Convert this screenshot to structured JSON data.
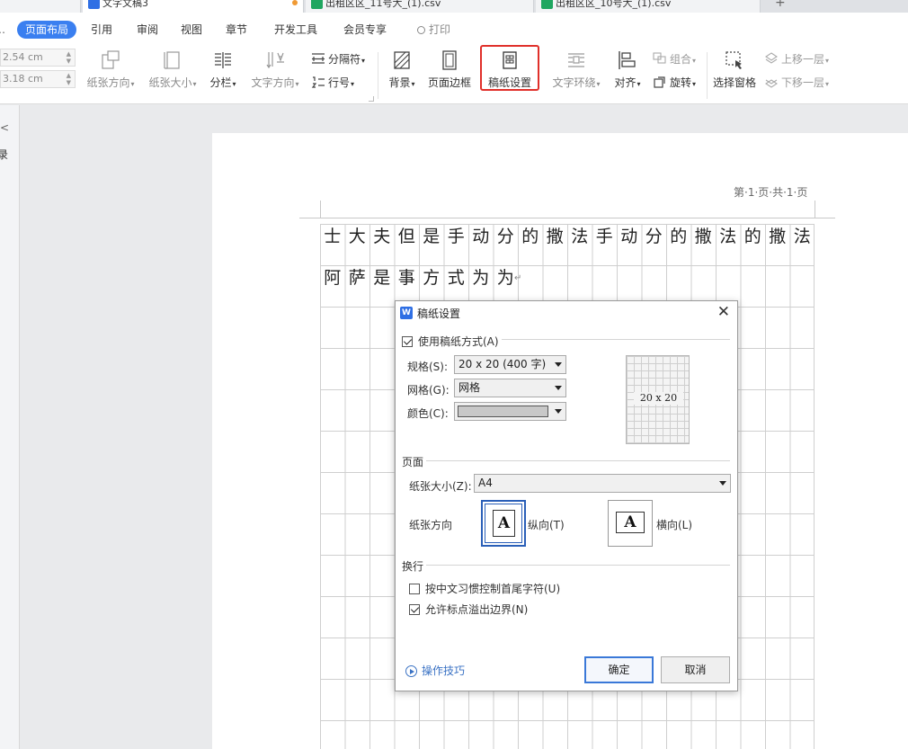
{
  "file_tabs": [
    {
      "label": "",
      "kind": "home"
    },
    {
      "label": "文字文稿3",
      "kind": "writer"
    },
    {
      "label": "出租区区_11号大_(1).csv",
      "kind": "sheet"
    },
    {
      "label": "出租区区_10号大_(1).csv",
      "kind": "sheet"
    }
  ],
  "menu": {
    "items": [
      "页面布局",
      "引用",
      "审阅",
      "视图",
      "章节",
      "开发工具",
      "会员专享"
    ],
    "search_label": "打印"
  },
  "ribbon": {
    "margin_top": "2.54 cm",
    "margin_bottom": "3.18 cm",
    "orientation": "纸张方向",
    "paper_size": "纸张大小",
    "columns": "分栏",
    "text_direction": "文字方向",
    "separator": "分隔符",
    "line_number": "行号",
    "background": "背景",
    "page_border": "页面边框",
    "manuscript": "稿纸设置",
    "text_wrap": "文字环绕",
    "align": "对齐",
    "group": "组合",
    "rotate": "旋转",
    "selection_pane": "选择窗格",
    "bring_forward": "上移一层",
    "send_backward": "下移一层"
  },
  "left_pane": {
    "label": "录"
  },
  "document": {
    "page_number": "第·1·页·共·1·页",
    "line1": [
      "士",
      "大",
      "夫",
      "但",
      "是",
      "手",
      "动",
      "分",
      "的",
      "撒",
      "法",
      "手",
      "动",
      "分",
      "的",
      "撒",
      "法",
      "的",
      "撒",
      "法"
    ],
    "line2": [
      "阿",
      "萨",
      "是",
      "事",
      "方",
      "式",
      "为",
      "为"
    ],
    "para_mark": "↵"
  },
  "dialog": {
    "title": "稿纸设置",
    "use_manuscript": {
      "label": "使用稿纸方式(A)",
      "checked": true
    },
    "spec": {
      "label": "规格(S):",
      "value": "20 x 20 (400 字)"
    },
    "grid": {
      "label": "网格(G):",
      "value": "网格"
    },
    "color": {
      "label": "颜色(C):",
      "value": "#c8c8c8"
    },
    "preview_label": "20 x 20",
    "page_section": "页面",
    "paper_size": {
      "label": "纸张大小(Z):",
      "value": "A4"
    },
    "orientation": {
      "label": "纸张方向",
      "portrait": "纵向(T)",
      "landscape": "横向(L)",
      "selected": "portrait"
    },
    "wrap_section": "换行",
    "opt_chinese_rules": {
      "label": "按中文习惯控制首尾字符(U)",
      "checked": false
    },
    "opt_punct_overflow": {
      "label": "允许标点溢出边界(N)",
      "checked": true
    },
    "tips": "操作技巧",
    "ok": "确定",
    "cancel": "取消"
  }
}
